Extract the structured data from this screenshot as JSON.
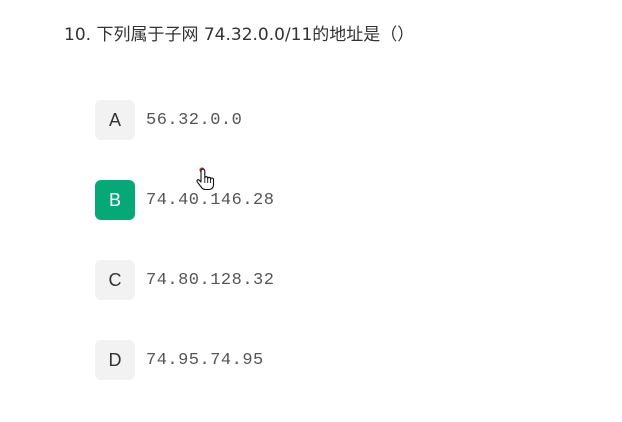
{
  "question": {
    "text": "10. 下列属于子网 74.32.0.0/11的地址是（）"
  },
  "options": [
    {
      "letter": "A",
      "value": "56.32.0.0",
      "selected": false
    },
    {
      "letter": "B",
      "value": "74.40.146.28",
      "selected": true
    },
    {
      "letter": "C",
      "value": "74.80.128.32",
      "selected": false
    },
    {
      "letter": "D",
      "value": "74.95.74.95",
      "selected": false
    }
  ],
  "colors": {
    "selected_bg": "#07a878",
    "unselected_bg": "#f2f2f2",
    "text": "#333333"
  },
  "icons": {
    "cursor": "hand-pointer-icon"
  }
}
